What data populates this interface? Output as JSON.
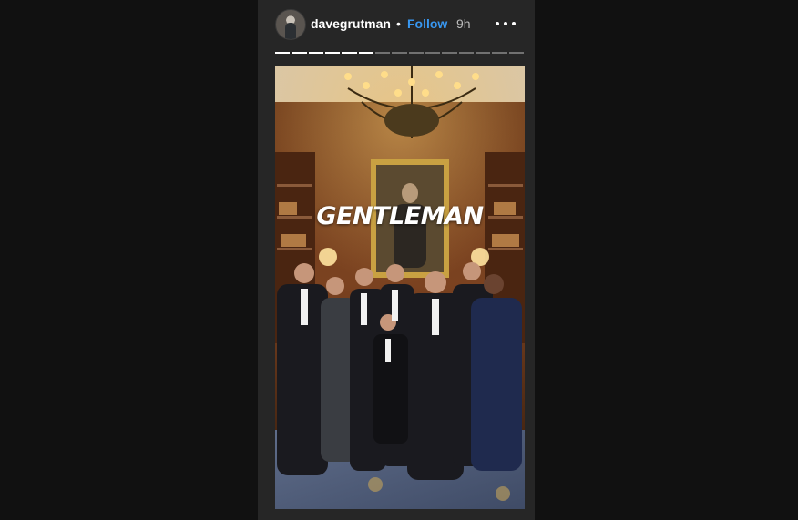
{
  "story": {
    "username": "davegrutman",
    "separator": "•",
    "follow_label": "Follow",
    "time_ago": "9h",
    "progress": {
      "total_segments": 15,
      "completed_segments": 6
    },
    "caption": "GENTLEMAN",
    "avatar_icon": "profile-avatar",
    "more_icon": "more-options-icon"
  },
  "colors": {
    "background": "#111111",
    "panel": "#262626",
    "link": "#3897f0"
  }
}
